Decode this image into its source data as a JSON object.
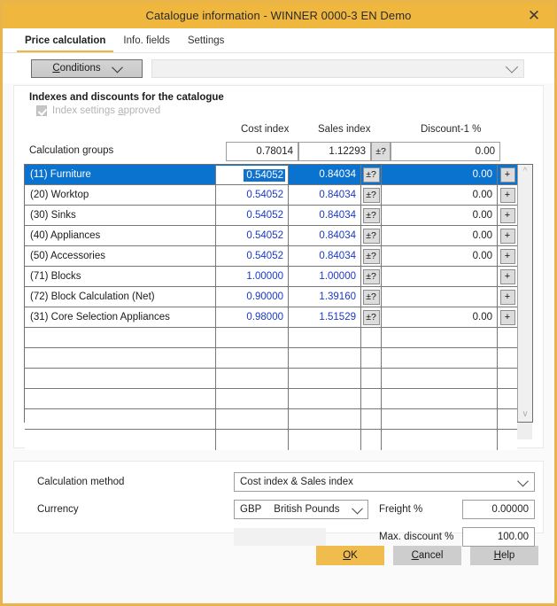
{
  "window": {
    "title": "Catalogue information - WINNER 0000-3 EN Demo",
    "close_icon": "close-icon",
    "accent_color": "#efb73e",
    "selection_color": "#0a72cf"
  },
  "tabs": [
    {
      "label": "Price calculation",
      "active": true
    },
    {
      "label": "Info. fields",
      "active": false
    },
    {
      "label": "Settings",
      "active": false
    }
  ],
  "conditions": {
    "button_label": "Conditions",
    "combo_value": ""
  },
  "index_panel": {
    "title": "Indexes and discounts for the catalogue",
    "approved_label": "Index settings approved",
    "approved_checked": true,
    "columns": {
      "name": "Calculation groups",
      "cost_index": "Cost index",
      "sales_index": "Sales index",
      "pm": "±?",
      "discount1": "Discount-1 %"
    },
    "summary": {
      "label": "Calculation groups",
      "cost_index": "0.78014",
      "sales_index": "1.12293",
      "pm": "±?",
      "discount1": "0.00"
    },
    "rows": [
      {
        "name": "(11) Furniture",
        "cost_index": "0.54052",
        "sales_index": "0.84034",
        "pm": "±?",
        "discount1": "0.00",
        "plus": "+",
        "selected": true,
        "editing": true,
        "edit_value": "0.54052"
      },
      {
        "name": "(20) Worktop",
        "cost_index": "0.54052",
        "sales_index": "0.84034",
        "pm": "±?",
        "discount1": "0.00",
        "plus": "+",
        "selected": false,
        "editing": false
      },
      {
        "name": "(30) Sinks",
        "cost_index": "0.54052",
        "sales_index": "0.84034",
        "pm": "±?",
        "discount1": "0.00",
        "plus": "+",
        "selected": false,
        "editing": false
      },
      {
        "name": "(40) Appliances",
        "cost_index": "0.54052",
        "sales_index": "0.84034",
        "pm": "±?",
        "discount1": "0.00",
        "plus": "+",
        "selected": false,
        "editing": false
      },
      {
        "name": "(50) Accessories",
        "cost_index": "0.54052",
        "sales_index": "0.84034",
        "pm": "±?",
        "discount1": "0.00",
        "plus": "+",
        "selected": false,
        "editing": false
      },
      {
        "name": "(71) Blocks",
        "cost_index": "1.00000",
        "sales_index": "1.00000",
        "pm": "±?",
        "discount1": "",
        "plus": "+",
        "selected": false,
        "editing": false
      },
      {
        "name": "(72) Block Calculation (Net)",
        "cost_index": "0.90000",
        "sales_index": "1.39160",
        "pm": "±?",
        "discount1": "",
        "plus": "+",
        "selected": false,
        "editing": false
      },
      {
        "name": "(31) Core Selection Appliances",
        "cost_index": "0.98000",
        "sales_index": "1.51529",
        "pm": "±?",
        "discount1": "0.00",
        "plus": "+",
        "selected": false,
        "editing": false
      },
      {
        "name": "",
        "cost_index": "",
        "sales_index": "",
        "pm": "",
        "discount1": "",
        "plus": "",
        "selected": false,
        "editing": false
      },
      {
        "name": "",
        "cost_index": "",
        "sales_index": "",
        "pm": "",
        "discount1": "",
        "plus": "",
        "selected": false,
        "editing": false
      },
      {
        "name": "",
        "cost_index": "",
        "sales_index": "",
        "pm": "",
        "discount1": "",
        "plus": "",
        "selected": false,
        "editing": false
      },
      {
        "name": "",
        "cost_index": "",
        "sales_index": "",
        "pm": "",
        "discount1": "",
        "plus": "",
        "selected": false,
        "editing": false
      },
      {
        "name": "",
        "cost_index": "",
        "sales_index": "",
        "pm": "",
        "discount1": "",
        "plus": "",
        "selected": false,
        "editing": false
      },
      {
        "name": "",
        "cost_index": "",
        "sales_index": "",
        "pm": "",
        "discount1": "",
        "plus": "",
        "selected": false,
        "editing": false
      }
    ],
    "scrollbar": {
      "up_icon": "chevron-up-icon",
      "down_icon": "chevron-down-icon"
    }
  },
  "settings": {
    "calculation_method_label": "Calculation method",
    "calculation_method_value": "Cost index & Sales index",
    "currency_label": "Currency",
    "currency_code": "GBP",
    "currency_name": "British Pounds",
    "freight_label": "Freight %",
    "freight_value": "0.00000",
    "max_discount_label": "Max. discount %",
    "max_discount_value": "100.00"
  },
  "buttons": {
    "ok": "OK",
    "cancel": "Cancel",
    "help": "Help"
  }
}
